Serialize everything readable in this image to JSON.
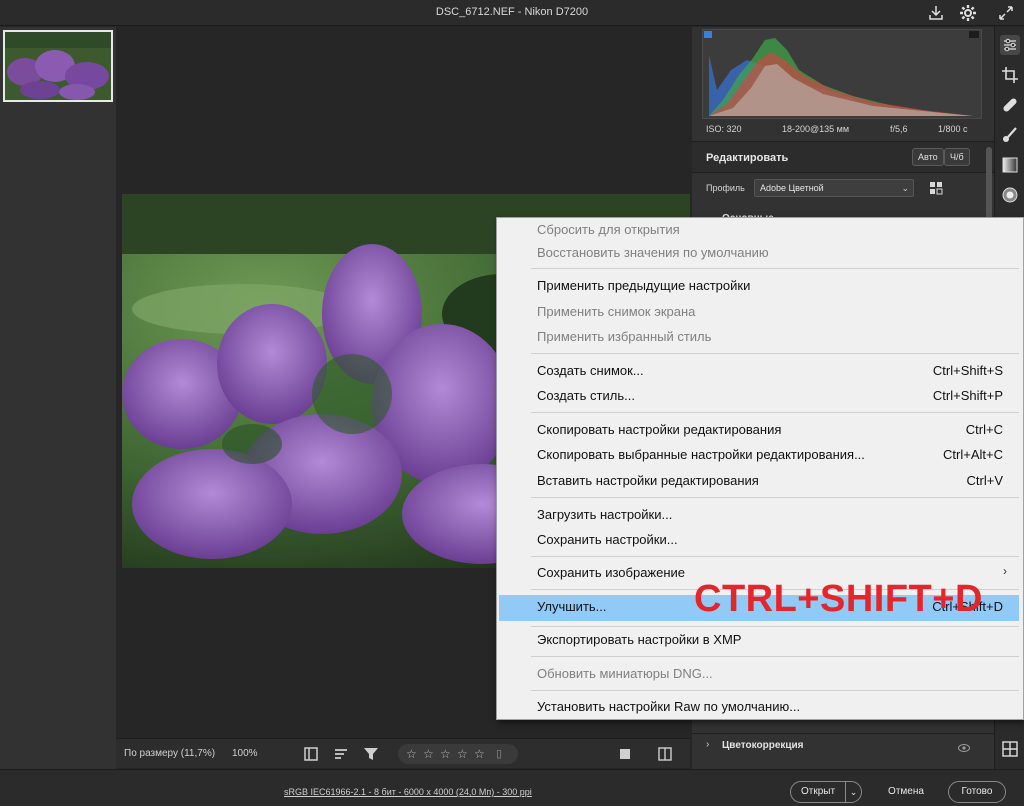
{
  "window": {
    "title": "DSC_6712.NEF  -  Nikon D7200"
  },
  "icons": {
    "titlebar": [
      "save-icon",
      "gear-icon",
      "fullscreen-icon"
    ],
    "tools": [
      "edit-sliders-icon",
      "crop-icon",
      "healing-icon",
      "brush-icon",
      "gradient-icon",
      "radial-icon",
      "grid-icon"
    ]
  },
  "view_bar": {
    "zoom_fit": "По размеру (11,7%)",
    "zoom_percent": "100%",
    "rating_stars": 5
  },
  "panel": {
    "info": {
      "iso": "ISO: 320",
      "lens": "18-200@135 мм",
      "aperture": "f/5,6",
      "shutter": "1/800 с"
    },
    "edit_title": "Редактировать",
    "auto_button": "Авто",
    "bw_button": "Ч/б",
    "profile_label": "Профиль",
    "profile_value": "Adobe Цветной",
    "section_basic": "Основные",
    "section_color": "Цветокоррекция"
  },
  "footer": {
    "file_info": "sRGB IEC61966-2.1 - 8 бит - 6000 x 4000 (24,0 Мп) - 300 ppi",
    "open_button": "Открыт",
    "cancel_button": "Отмена",
    "done_button": "Готово"
  },
  "menu": {
    "items": [
      {
        "label": "Сбросить для открытия",
        "shortcut": "",
        "disabled": true
      },
      {
        "label": "Восстановить значения по умолчанию",
        "shortcut": "",
        "disabled": true
      },
      {
        "label": "Применить предыдущие настройки",
        "shortcut": "",
        "disabled": false
      },
      {
        "label": "Применить снимок экрана",
        "shortcut": "",
        "disabled": true
      },
      {
        "label": "Применить избранный стиль",
        "shortcut": "",
        "disabled": true
      },
      {
        "label": "Создать снимок...",
        "shortcut": "Ctrl+Shift+S",
        "disabled": false
      },
      {
        "label": "Создать стиль...",
        "shortcut": "Ctrl+Shift+P",
        "disabled": false
      },
      {
        "label": "Скопировать настройки редактирования",
        "shortcut": "Ctrl+C",
        "disabled": false
      },
      {
        "label": "Скопировать выбранные настройки редактирования...",
        "shortcut": "Ctrl+Alt+C",
        "disabled": false
      },
      {
        "label": "Вставить настройки редактирования",
        "shortcut": "Ctrl+V",
        "disabled": false
      },
      {
        "label": "Загрузить настройки...",
        "shortcut": "",
        "disabled": false
      },
      {
        "label": "Сохранить настройки...",
        "shortcut": "",
        "disabled": false
      },
      {
        "label": "Сохранить изображение",
        "shortcut": "",
        "disabled": false,
        "submenu": true
      },
      {
        "label": "Улучшить...",
        "shortcut": "Ctrl+Shift+D",
        "disabled": false,
        "highlight": true
      },
      {
        "label": "Экспортировать настройки в XMP",
        "shortcut": "",
        "disabled": false
      },
      {
        "label": "Обновить миниатюры DNG...",
        "shortcut": "",
        "disabled": true
      },
      {
        "label": "Установить настройки Raw по умолчанию...",
        "shortcut": "",
        "disabled": false
      }
    ]
  },
  "annotation": {
    "shortcut_overlay": "CTRL+SHIFT+D",
    "color": "#e3262b"
  }
}
